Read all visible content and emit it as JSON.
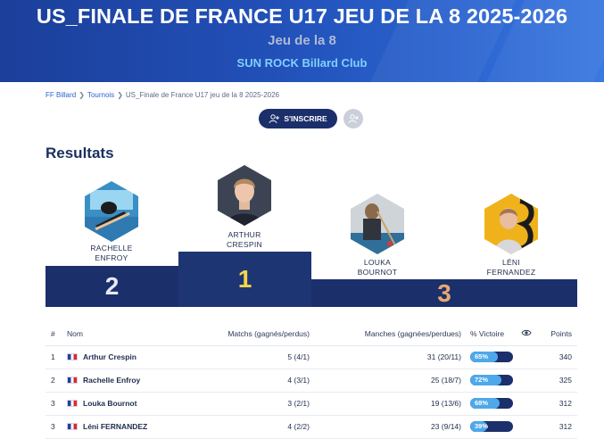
{
  "hero": {
    "title": "US_FINALE DE FRANCE U17 JEU DE LA 8 2025-2026",
    "subtitle": "Jeu de la 8",
    "club": "SUN ROCK Billard Club"
  },
  "breadcrumb": [
    "FF Billard",
    "Tournois",
    "US_Finale de France U17 jeu de la 8 2025-2026"
  ],
  "actions": {
    "inscrire": "S'INSCRIRE"
  },
  "results_title": "Resultats",
  "podium": [
    {
      "rank": "2",
      "name_line1": "RACHELLE",
      "name_line2": "ENFROY"
    },
    {
      "rank": "1",
      "name_line1": "ARTHUR",
      "name_line2": "CRESPIN"
    },
    {
      "rank": "3",
      "name_line1": "LOUKA",
      "name_line2": "BOURNOT"
    },
    {
      "rank": "3",
      "name_line1": "LÉNI",
      "name_line2": "FERNANDEZ"
    }
  ],
  "table": {
    "headers": {
      "rank": "#",
      "name": "Nom",
      "matchs": "Matchs (gagnés/perdus)",
      "manches": "Manches (gagnées/perdues)",
      "pct": "% Victoire",
      "points": "Points"
    },
    "rows": [
      {
        "rank": "1",
        "name": "Arthur Crespin",
        "matchs": "5 (4/1)",
        "manches": "31 (20/11)",
        "pct": "65%",
        "pct_value": 65,
        "points": "340"
      },
      {
        "rank": "2",
        "name": "Rachelle Enfroy",
        "matchs": "4 (3/1)",
        "manches": "25 (18/7)",
        "pct": "72%",
        "pct_value": 72,
        "points": "325"
      },
      {
        "rank": "3",
        "name": "Louka Bournot",
        "matchs": "3 (2/1)",
        "manches": "19 (13/6)",
        "pct": "68%",
        "pct_value": 68,
        "points": "312"
      },
      {
        "rank": "3",
        "name": "Léni FERNANDEZ",
        "matchs": "4 (2/2)",
        "manches": "23 (9/14)",
        "pct": "39%",
        "pct_value": 39,
        "points": "312"
      }
    ]
  },
  "colors": {
    "hero": "#2250b8",
    "navy": "#1b2f6b",
    "bar_fill": "#4ea8ea",
    "gold": "#f3d54a",
    "silver": "#e6eaf2",
    "bronze": "#e8a86f"
  }
}
